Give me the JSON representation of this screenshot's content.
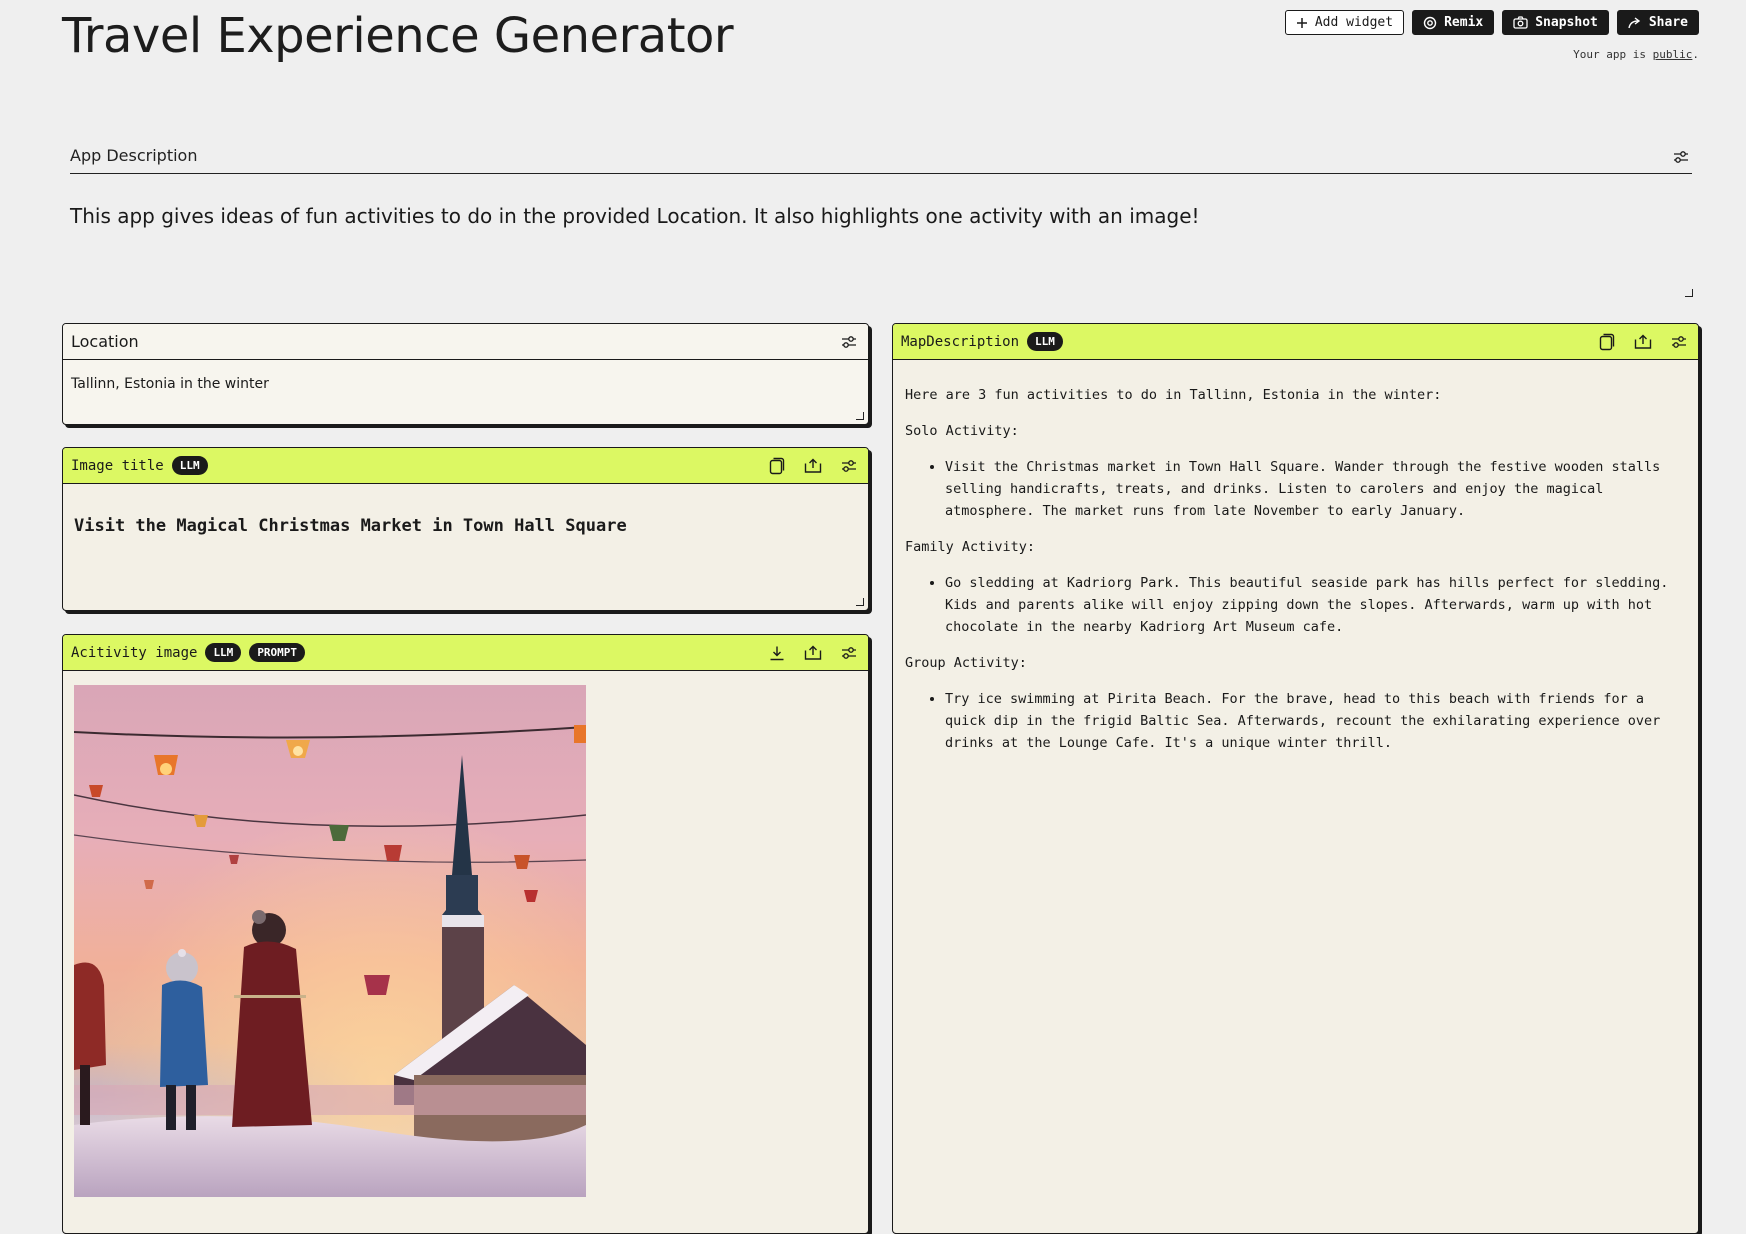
{
  "app": {
    "title": "Travel Experience Generator",
    "visibility_prefix": "Your app is ",
    "visibility_link": "public",
    "visibility_suffix": "."
  },
  "toolbar": {
    "add_widget_label": "Add widget",
    "remix_label": "Remix",
    "snapshot_label": "Snapshot",
    "share_label": "Share"
  },
  "description": {
    "label": "App Description",
    "text": "This app gives ideas of fun activities to do in the provided Location. It also highlights one activity with an image!"
  },
  "location": {
    "label": "Location",
    "value": "Tallinn, Estonia in the winter"
  },
  "image_title": {
    "label": "Image title",
    "badge": "LLM",
    "value": "Visit the Magical Christmas Market in Town Hall Square"
  },
  "activity_image": {
    "label": "Acitivity image",
    "badges": [
      "LLM",
      "PROMPT"
    ]
  },
  "map_description": {
    "label": "MapDescription",
    "badge": "LLM",
    "intro": "Here are 3 fun activities to do in Tallinn, Estonia in the winter:",
    "sections": [
      {
        "heading": "Solo Activity:",
        "item": "Visit the Christmas market in Town Hall Square. Wander through the festive wooden stalls selling handicrafts, treats, and drinks. Listen to carolers and enjoy the magical atmosphere. The market runs from late November to early January."
      },
      {
        "heading": "Family Activity:",
        "item": "Go sledding at Kadriorg Park. This beautiful seaside park has hills perfect for sledding. Kids and parents alike will enjoy zipping down the slopes. Afterwards, warm up with hot chocolate in the nearby Kadriorg Art Museum cafe."
      },
      {
        "heading": "Group Activity:",
        "item": "Try ice swimming at Pirita Beach. For the brave, head to this beach with friends for a quick dip in the frigid Baltic Sea. Afterwards, recount the exhilarating experience over drinks at the Lounge Cafe. It's a unique winter thrill."
      }
    ]
  },
  "colors": {
    "accent": "#dcf863",
    "card_bg": "#f3f0e6",
    "ink": "#1a1a1a",
    "page_bg": "#efefef"
  }
}
